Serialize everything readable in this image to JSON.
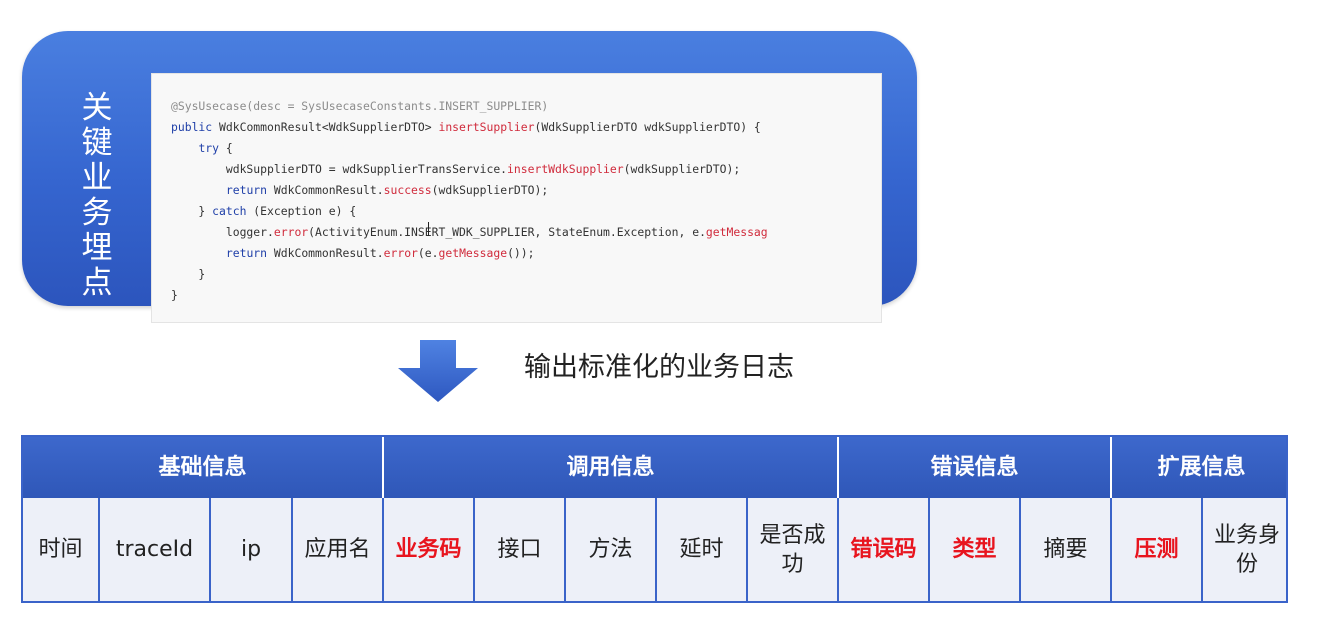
{
  "panel": {
    "label_chars": [
      "关",
      "键",
      "业",
      "务",
      "埋",
      "点"
    ],
    "code_lines": [
      [
        {
          "t": "@SysUsecase(desc = SysUsecaseConstants.INSERT_SUPPLIER)",
          "c": "ann"
        }
      ],
      [
        {
          "t": "public ",
          "c": "kw"
        },
        {
          "t": "WdkCommonResult<WdkSupplierDTO> ",
          "c": ""
        },
        {
          "t": "insertSupplier",
          "c": "fn"
        },
        {
          "t": "(WdkSupplierDTO wdkSupplierDTO) {",
          "c": ""
        }
      ],
      [
        {
          "t": "    ",
          "c": ""
        },
        {
          "t": "try",
          "c": "kw"
        },
        {
          "t": " {",
          "c": ""
        }
      ],
      [
        {
          "t": "        wdkSupplierDTO = wdkSupplierTransService.",
          "c": ""
        },
        {
          "t": "insertWdkSupplier",
          "c": "fn"
        },
        {
          "t": "(wdkSupplierDTO);",
          "c": ""
        }
      ],
      [
        {
          "t": "        ",
          "c": ""
        },
        {
          "t": "return",
          "c": "kw"
        },
        {
          "t": " WdkCommonResult.",
          "c": ""
        },
        {
          "t": "success",
          "c": "fn"
        },
        {
          "t": "(wdkSupplierDTO);",
          "c": ""
        }
      ],
      [
        {
          "t": "    } ",
          "c": ""
        },
        {
          "t": "catch",
          "c": "kw"
        },
        {
          "t": " (Exception e) {",
          "c": ""
        }
      ],
      [
        {
          "t": "        logger.",
          "c": ""
        },
        {
          "t": "error",
          "c": "fn"
        },
        {
          "t": "(ActivityEnum.INSERT_WDK_SUPPLIER, StateEnum.Exception, e.",
          "c": ""
        },
        {
          "t": "getMessag",
          "c": "fn"
        }
      ],
      [
        {
          "t": "        ",
          "c": ""
        },
        {
          "t": "return",
          "c": "kw"
        },
        {
          "t": " WdkCommonResult.",
          "c": ""
        },
        {
          "t": "error",
          "c": "fn"
        },
        {
          "t": "(e.",
          "c": ""
        },
        {
          "t": "getMessage",
          "c": "fn"
        },
        {
          "t": "());",
          "c": ""
        }
      ],
      [
        {
          "t": "    }",
          "c": ""
        }
      ],
      [
        {
          "t": "}",
          "c": ""
        }
      ]
    ]
  },
  "caption": "输出标准化的业务日志",
  "colors": {
    "header_blue": "#2f57b8",
    "panel_blue": "#3565cf",
    "highlight_red": "#e8141e"
  },
  "table": {
    "groups": [
      {
        "label": "基础信息",
        "span": 4
      },
      {
        "label": "调用信息",
        "span": 5
      },
      {
        "label": "错误信息",
        "span": 3
      },
      {
        "label": "扩展信息",
        "span": 2
      }
    ],
    "fields": [
      {
        "label": "时间",
        "highlight": false
      },
      {
        "label": "traceId",
        "highlight": false
      },
      {
        "label": "ip",
        "highlight": false
      },
      {
        "label": "应用名",
        "highlight": false
      },
      {
        "label": "业务码",
        "highlight": true
      },
      {
        "label": "接口",
        "highlight": false
      },
      {
        "label": "方法",
        "highlight": false
      },
      {
        "label": "延时",
        "highlight": false
      },
      {
        "label": "是否成功",
        "highlight": false
      },
      {
        "label": "错误码",
        "highlight": true
      },
      {
        "label": "类型",
        "highlight": true
      },
      {
        "label": "摘要",
        "highlight": false
      },
      {
        "label": "压测",
        "highlight": true
      },
      {
        "label": "业务身份",
        "highlight": false
      }
    ]
  }
}
